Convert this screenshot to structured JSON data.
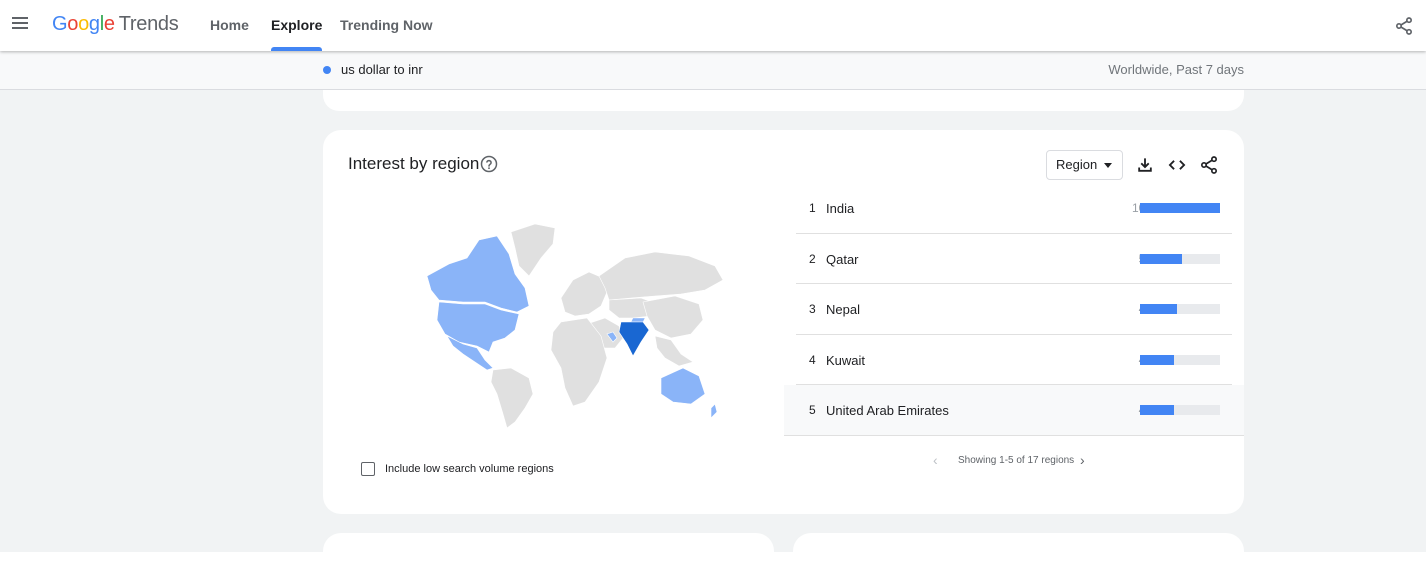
{
  "app": {
    "logo_google": "Google",
    "logo_trends": "Trends",
    "nav": [
      {
        "label": "Home"
      },
      {
        "label": "Explore"
      },
      {
        "label": "Trending Now"
      }
    ]
  },
  "subbar": {
    "term": "us dollar to inr",
    "term_color": "#4285f4",
    "scope": "Worldwide, Past 7 days"
  },
  "card": {
    "title": "Interest by region",
    "region_select": "Region",
    "checkbox_label": "Include low search volume regions",
    "pager_text": "Showing 1-5 of 17 regions",
    "pager_prev": "‹",
    "pager_next": "›",
    "rows": [
      {
        "rank": "1",
        "name": "India",
        "value": 100
      },
      {
        "rank": "2",
        "name": "Qatar",
        "value": 53
      },
      {
        "rank": "3",
        "name": "Nepal",
        "value": 46
      },
      {
        "rank": "4",
        "name": "Kuwait",
        "value": 42
      },
      {
        "rank": "5",
        "name": "United Arab Emirates",
        "value": 42
      }
    ]
  },
  "colors": {
    "accent": "#4285f4",
    "map_high": "#1967d2",
    "map_low": "#8ab4f8",
    "map_none": "#e0e0e0"
  }
}
